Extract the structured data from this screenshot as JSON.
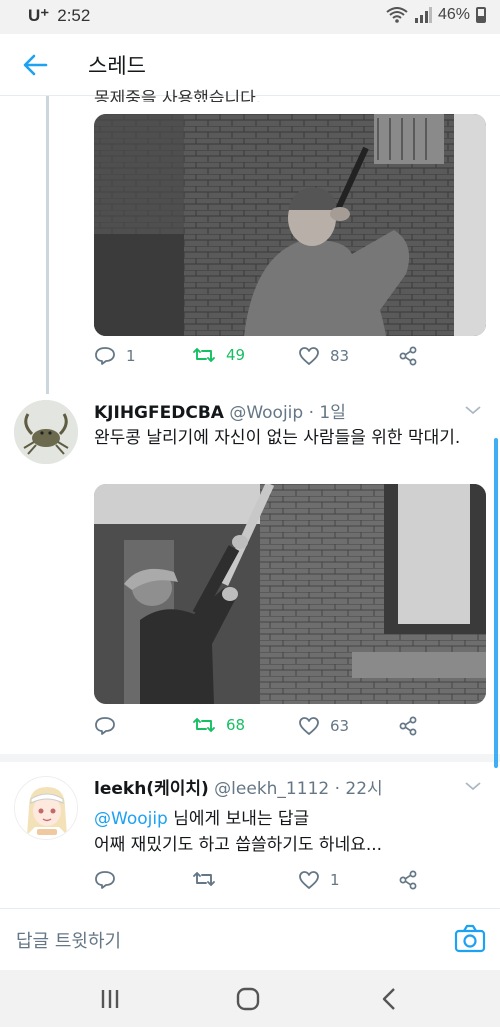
{
  "status_bar": {
    "carrier": "U⁺",
    "time": "2:52",
    "battery": "46%"
  },
  "header": {
    "title": "스레드"
  },
  "tweet1": {
    "cut_text": "몽제중을 사용했습니다.",
    "photo_icon": "photo-woman-blowing-peashooter",
    "actions": {
      "replies": "1",
      "retweets": "49",
      "likes": "83"
    }
  },
  "tweet2": {
    "name": "KJIHGFEDCBA",
    "handle": "@Woojip · 1일",
    "text": "완두콩 날리기에 자신이 없는 사람들을 위한 막대기.",
    "photo_icon": "photo-man-with-long-pole",
    "actions": {
      "replies": "",
      "retweets": "68",
      "likes": "63"
    }
  },
  "tweet3": {
    "name": "leekh(케이치)",
    "handle": "@leekh_1112 · 22시",
    "reply_mention": "@Woojip",
    "reply_suffix": " 님에게 보내는 답글",
    "text": "어째 재밌기도 하고 씁쓸하기도 하네요...",
    "actions": {
      "replies": "",
      "retweets": "",
      "likes": "1"
    }
  },
  "composer": {
    "placeholder": "답글 트윗하기"
  },
  "colors": {
    "accent": "#1da1f2",
    "retweet_green": "#17bf63",
    "muted": "#657786"
  }
}
